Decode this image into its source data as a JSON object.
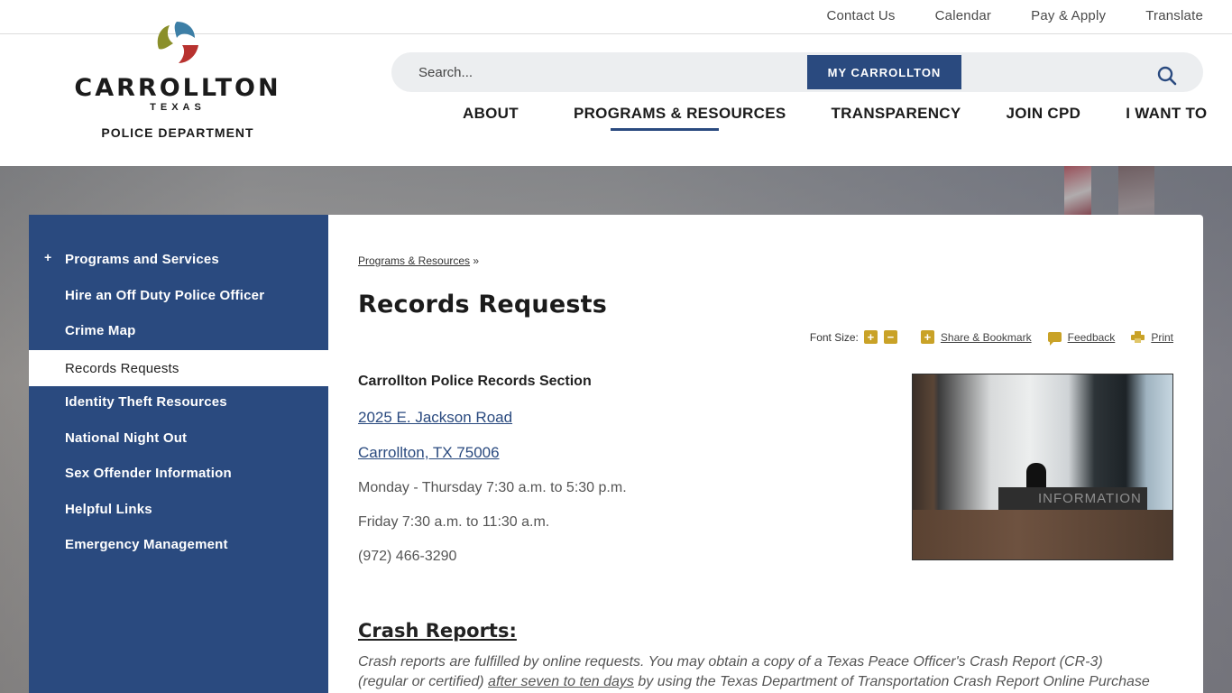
{
  "util_links": [
    "Contact Us",
    "Calendar",
    "Pay & Apply",
    "Translate"
  ],
  "logo": {
    "word": "CARROLLTON",
    "sub": "TEXAS",
    "dept": "POLICE DEPARTMENT"
  },
  "search": {
    "placeholder": "Search...",
    "my_button": "MY CARROLLTON"
  },
  "main_nav": [
    "ABOUT",
    "PROGRAMS & RESOURCES",
    "TRANSPARENCY",
    "JOIN CPD",
    "I WANT TO"
  ],
  "sidebar": {
    "items": [
      {
        "label": "Programs and Services",
        "expander": "+"
      },
      {
        "label": "Hire an Off Duty Police Officer"
      },
      {
        "label": "Crime Map"
      },
      {
        "label": "Records Requests"
      },
      {
        "label": "Identity Theft Resources"
      },
      {
        "label": "National Night Out"
      },
      {
        "label": "Sex Offender Information"
      },
      {
        "label": "Helpful Links"
      },
      {
        "label": "Emergency Management"
      }
    ]
  },
  "breadcrumb": {
    "link": "Programs & Resources",
    "separator": "»"
  },
  "page_title": "Records Requests",
  "tools": {
    "font_size_label": "Font Size:",
    "increase": "+",
    "decrease": "−",
    "share_plus": "+",
    "share": "Share & Bookmark",
    "feedback": "Feedback",
    "print": "Print"
  },
  "records": {
    "section_title": "Carrollton Police Records Section",
    "address1": "2025 E. Jackson Road",
    "address2": "Carrollton, TX 75006",
    "hours1": "Monday - Thursday 7:30 a.m. to 5:30 p.m.",
    "hours2": "Friday 7:30 a.m. to 11:30 a.m.",
    "phone": "(972) 466-3290"
  },
  "photo": {
    "desk_sign": "INFORMATION"
  },
  "crash": {
    "heading": "Crash Reports:",
    "text_before": "Crash reports are fulfilled by online requests. You may obtain a copy of a Texas Peace Officer's Crash Report (CR-3) (regular or certified) ",
    "link": "after seven to ten days",
    "text_after": " by using the Texas Department of Transportation Crash Report Online Purchase System."
  },
  "colors": {
    "brand_blue": "#2a4a7f",
    "accent_gold": "#c9a227"
  }
}
